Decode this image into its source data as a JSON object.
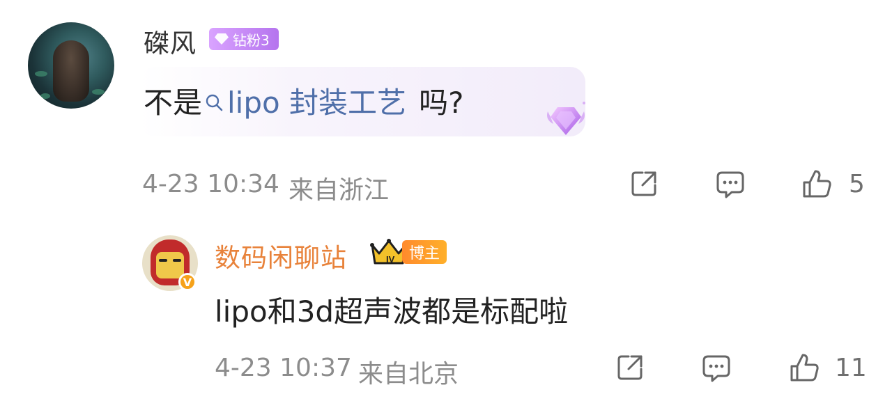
{
  "comments": [
    {
      "username": "磔风",
      "badge_label": "钻粉3",
      "text_prefix": "不是",
      "topic": "lipo 封装工艺",
      "text_suffix": "吗?",
      "time": "4-23 10:34",
      "location": "来自浙江",
      "likes": "5"
    },
    {
      "username": "数码闲聊站",
      "badge_label": "博主",
      "crown_text": "IV",
      "verified_mark": "V",
      "text": "lipo和3d超声波都是标配啦",
      "time": "4-23 10:37",
      "location": "来自北京",
      "likes": "11"
    }
  ],
  "icons": {
    "share": "share-icon",
    "comment": "comment-icon",
    "like": "like-icon",
    "search": "search-icon",
    "medal": "diamond-medal-icon",
    "crown": "crown-icon",
    "gem": "diamond-gem-icon"
  },
  "colors": {
    "topic": "#4f6fa9",
    "blogger_name": "#e8823a",
    "fan_badge": "#b574ee",
    "blogger_badge": "#ff8a2c",
    "meta": "#8c8c8c"
  }
}
